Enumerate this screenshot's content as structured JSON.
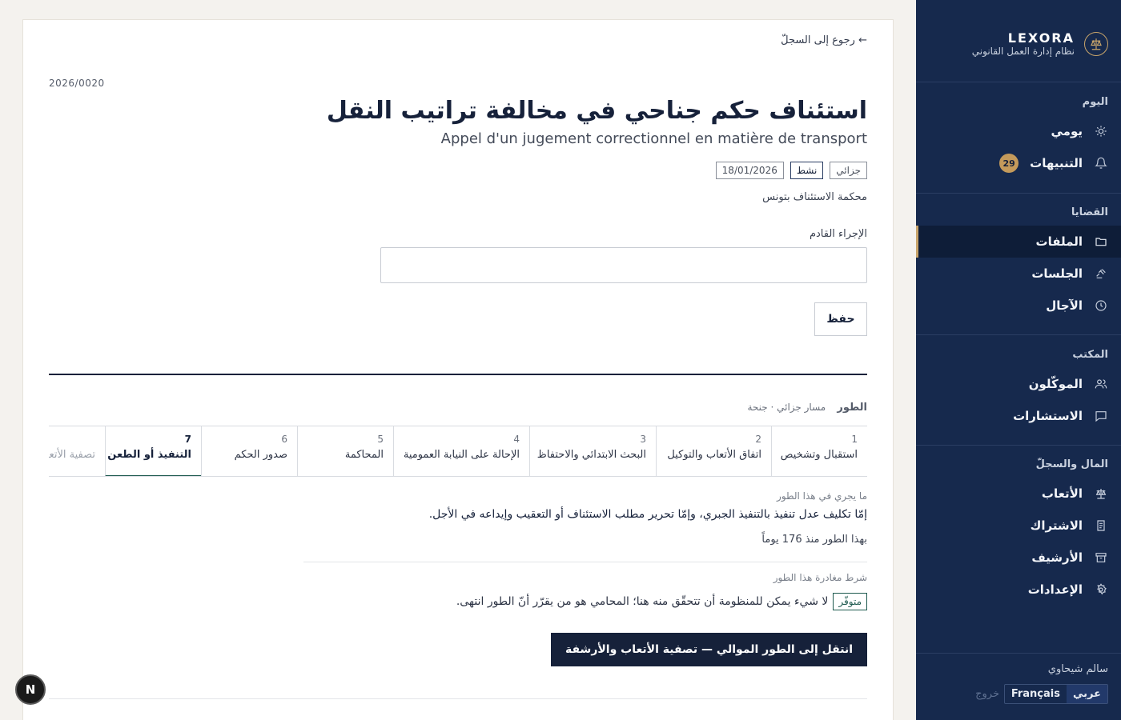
{
  "sidebar": {
    "brand_name": "LEXORA",
    "brand_subtitle": "نظام إدارة العمل القانوني",
    "sections": {
      "today": "اليوم",
      "cases": "القضايا",
      "office": "المكتب",
      "finance": "المال والسجلّ"
    },
    "items": {
      "daily": "يومي",
      "alerts": "التنبيهات",
      "alerts_count": "29",
      "files": "الملفات",
      "hearings": "الجلسات",
      "deadlines": "الآجال",
      "clients": "الموكّلون",
      "consultations": "الاستشارات",
      "fees": "الأتعاب",
      "subscription": "الاشتراك",
      "archive": "الأرشيف",
      "settings": "الإعدادات"
    },
    "user_name": "سالم شيحاوي",
    "lang_ar": "عربي",
    "lang_fr": "Français",
    "logout": "خروج"
  },
  "case": {
    "back_link": "← رجوع إلى السجلّ",
    "number": "2026/0020",
    "title_ar": "استئناف حكم جناحي في مخالفة تراتيب النقل",
    "title_fr": "Appel d'un jugement correctionnel en matière de transport",
    "tags": [
      "جزائي",
      "نشط",
      "18/01/2026"
    ],
    "court": "محكمة الاستئناف بتونس",
    "next_action_label": "الإجراء القادم",
    "next_action_value": "",
    "save_label": "حفظ"
  },
  "phase": {
    "title": "الطور",
    "subtitle": "مسار جزائي · جنحة",
    "steps": [
      {
        "num": "1",
        "label": "استقبال وتشخيص"
      },
      {
        "num": "2",
        "label": "اتفاق الأتعاب والتوكيل"
      },
      {
        "num": "3",
        "label": "البحث الابتدائي والاحتفاظ"
      },
      {
        "num": "4",
        "label": "الإحالة على النيابة العمومية"
      },
      {
        "num": "5",
        "label": "المحاكمة"
      },
      {
        "num": "6",
        "label": "صدور الحكم"
      },
      {
        "num": "7",
        "label": "التنفيذ أو الطعن"
      },
      {
        "num": "",
        "label": "تصفية الأتعاب والأرشفة"
      }
    ],
    "active_step": 7,
    "what_label": "ما يجري في هذا الطور",
    "what_text": "إمّا تكليف عدل تنفيذ بالتنفيذ الجبري، وإمّا تحرير مطلب الاستئناف أو التعقيب وإيداعه في الأجل.",
    "since_text": "بهذا الطور منذ 176 يوماً",
    "exit_label": "شرط مغادرة هذا الطور",
    "exit_badge": "متوفّر",
    "exit_text": "لا شيء يمكن للمنظومة أن تتحقّق منه هنا؛ المحامي هو من يقرّر أنّ الطور انتهى.",
    "cta": "انتقل إلى الطور الموالي — تصفية الأتعاب والأرشفة"
  },
  "fab_letter": "N",
  "colors": {
    "sidebar": "#16294d",
    "accent_gold": "#c8a46a",
    "primary_dark": "#16213a",
    "success": "#1e5a4f"
  }
}
